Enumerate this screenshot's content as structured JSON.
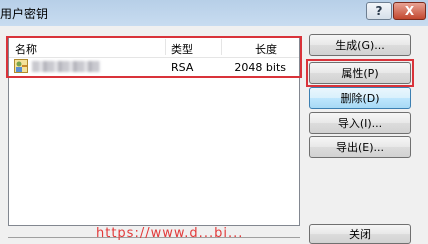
{
  "window": {
    "title": "用户密钥",
    "help_glyph": "?",
    "close_glyph": "X"
  },
  "list": {
    "columns": {
      "name": "名称",
      "type": "类型",
      "length": "长度"
    },
    "rows": [
      {
        "icon": "user-key-icon",
        "name": "",
        "type": "RSA",
        "length": "2048 bits"
      }
    ]
  },
  "buttons": {
    "generate": "生成(G)...",
    "properties": "属性(P)",
    "delete": "删除(D)",
    "import": "导入(I)...",
    "export": "导出(E)...",
    "close": "关闭"
  },
  "watermark": "https://www.d...bi...",
  "colors": {
    "highlight": "#d9333a",
    "focus_border": "#3c7fb1"
  }
}
